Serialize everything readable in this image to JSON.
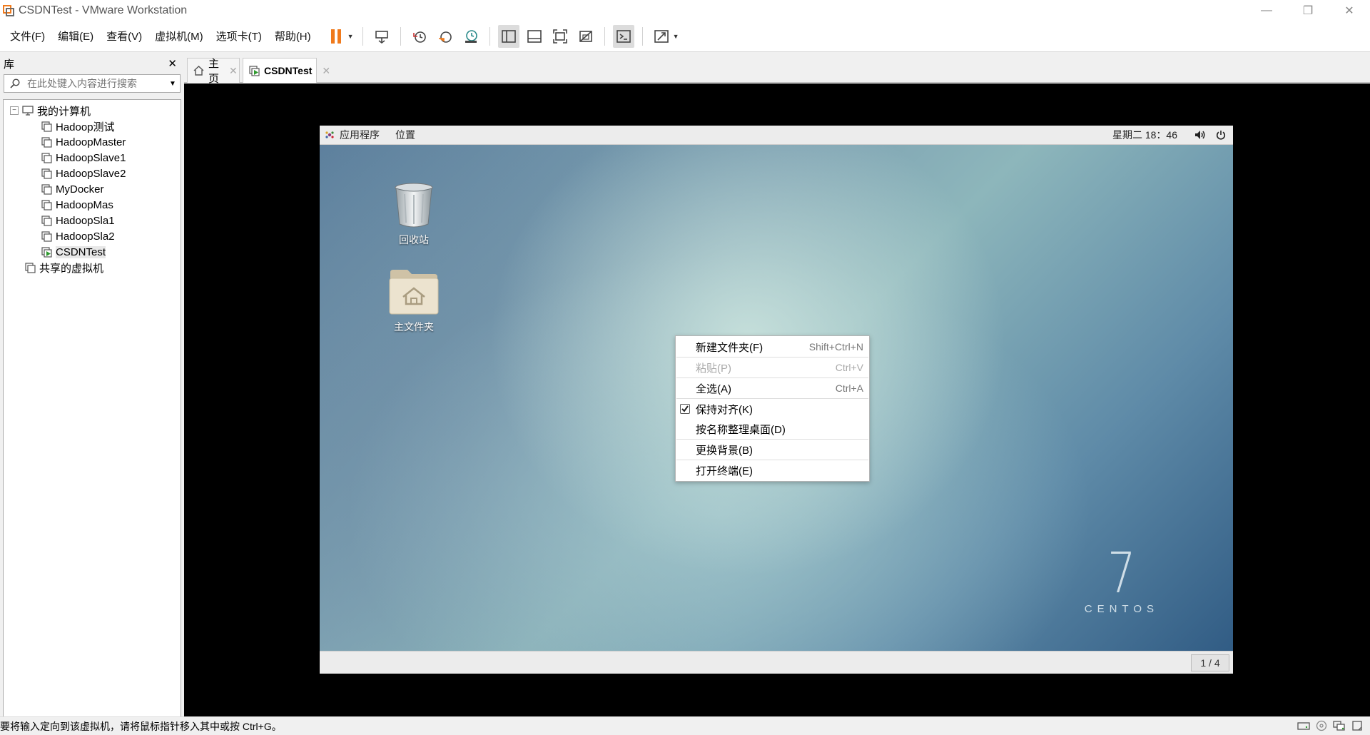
{
  "window": {
    "title": "CSDNTest - VMware Workstation",
    "controls": {
      "minimize": "—",
      "restore": "❐",
      "close": "✕"
    }
  },
  "menu": [
    {
      "label": "文件(F)"
    },
    {
      "label": "编辑(E)"
    },
    {
      "label": "查看(V)"
    },
    {
      "label": "虚拟机(M)"
    },
    {
      "label": "选项卡(T)"
    },
    {
      "label": "帮助(H)"
    }
  ],
  "library": {
    "title": "库",
    "close": "✕",
    "search_placeholder": "在此处键入内容进行搜索",
    "root": "我的计算机",
    "vms": [
      "Hadoop测试",
      "HadoopMaster",
      "HadoopSlave1",
      "HadoopSlave2",
      "MyDocker",
      "HadoopMas",
      "HadoopSla1",
      "HadoopSla2",
      "CSDNTest"
    ],
    "selected": "CSDNTest",
    "shared": "共享的虚拟机"
  },
  "tabs": [
    {
      "label": "主页",
      "close": "✕"
    },
    {
      "label": "CSDNTest",
      "close": "✕"
    }
  ],
  "guest": {
    "topbar": {
      "applications": "应用程序",
      "places": "位置",
      "clock": "星期二 18：46"
    },
    "desktop_icons": [
      {
        "label": "回收站",
        "icon": "trash-icon"
      },
      {
        "label": "主文件夹",
        "icon": "home-folder-icon"
      }
    ],
    "context_menu": [
      {
        "label": "新建文件夹(F)",
        "accel": "Shift+Ctrl+N",
        "enabled": true
      },
      {
        "label": "粘贴(P)",
        "accel": "Ctrl+V",
        "enabled": false
      },
      {
        "label": "全选(A)",
        "accel": "Ctrl+A",
        "enabled": true
      },
      {
        "label": "保持对齐(K)",
        "accel": "",
        "enabled": true,
        "checked": true
      },
      {
        "label": "按名称整理桌面(D)",
        "accel": "",
        "enabled": true
      },
      {
        "label": "更换背景(B)",
        "accel": "",
        "enabled": true
      },
      {
        "label": "打开终端(E)",
        "accel": "",
        "enabled": true
      }
    ],
    "logo": {
      "numeral": "7",
      "brand": "CENTOS"
    },
    "workspace": "1 / 4"
  },
  "status": {
    "text": "要将输入定向到该虚拟机，请将鼠标指针移入其中或按 Ctrl+G。"
  },
  "colors": {
    "pause_accent": "#f07a1c",
    "vm_background": "#000000",
    "selected_row": "#e8e8e8"
  }
}
